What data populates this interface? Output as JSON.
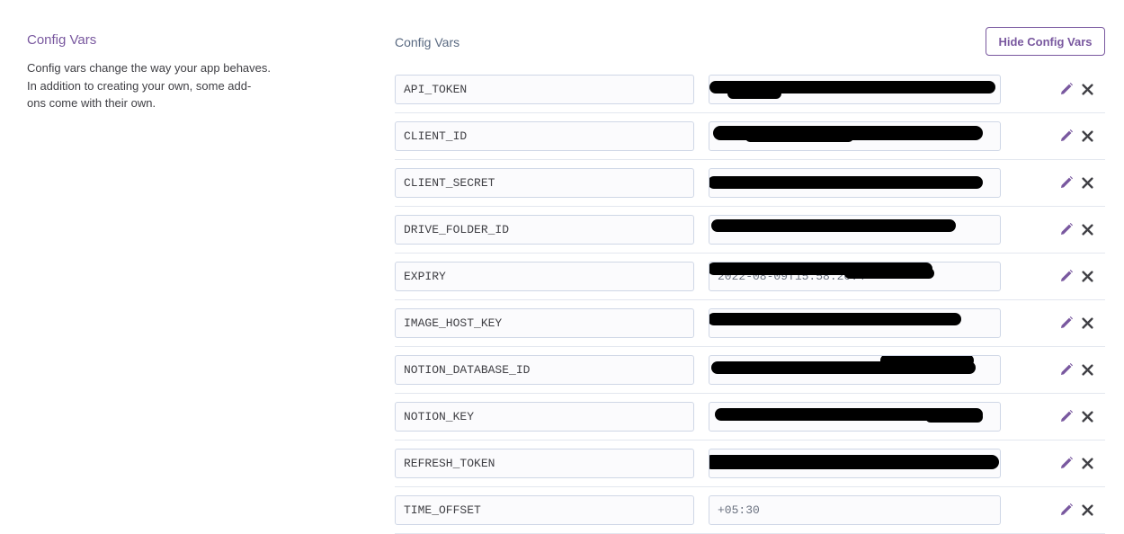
{
  "section": {
    "title": "Config Vars",
    "description_lines": [
      "Config vars change the way your app behaves.",
      "In addition to creating your own, some add-",
      "ons come with their own."
    ]
  },
  "panel": {
    "title": "Config Vars",
    "hide_button_label": "Hide Config Vars"
  },
  "vars": [
    {
      "key": "API_TOKEN",
      "value": "",
      "redacted": true
    },
    {
      "key": "CLIENT_ID",
      "value": "",
      "redacted": true
    },
    {
      "key": "CLIENT_SECRET",
      "value": "",
      "redacted": true
    },
    {
      "key": "DRIVE_FOLDER_ID",
      "value": "",
      "redacted": true
    },
    {
      "key": "EXPIRY",
      "value": "2022-08-09T15:58:20.4",
      "redacted": true
    },
    {
      "key": "IMAGE_HOST_KEY",
      "value": "",
      "redacted": true
    },
    {
      "key": "NOTION_DATABASE_ID",
      "value": "",
      "redacted": true
    },
    {
      "key": "NOTION_KEY",
      "value": "",
      "redacted": true
    },
    {
      "key": "REFRESH_TOKEN",
      "value": "",
      "redacted": true
    },
    {
      "key": "TIME_OFFSET",
      "value": "+05:30",
      "redacted": false
    }
  ],
  "icons": {
    "edit": "pencil-icon",
    "delete": "close-icon"
  },
  "colors": {
    "accent": "#79589f",
    "icon_edit": "#79589f",
    "icon_delete": "#3f3f44",
    "redaction": "#000000"
  }
}
